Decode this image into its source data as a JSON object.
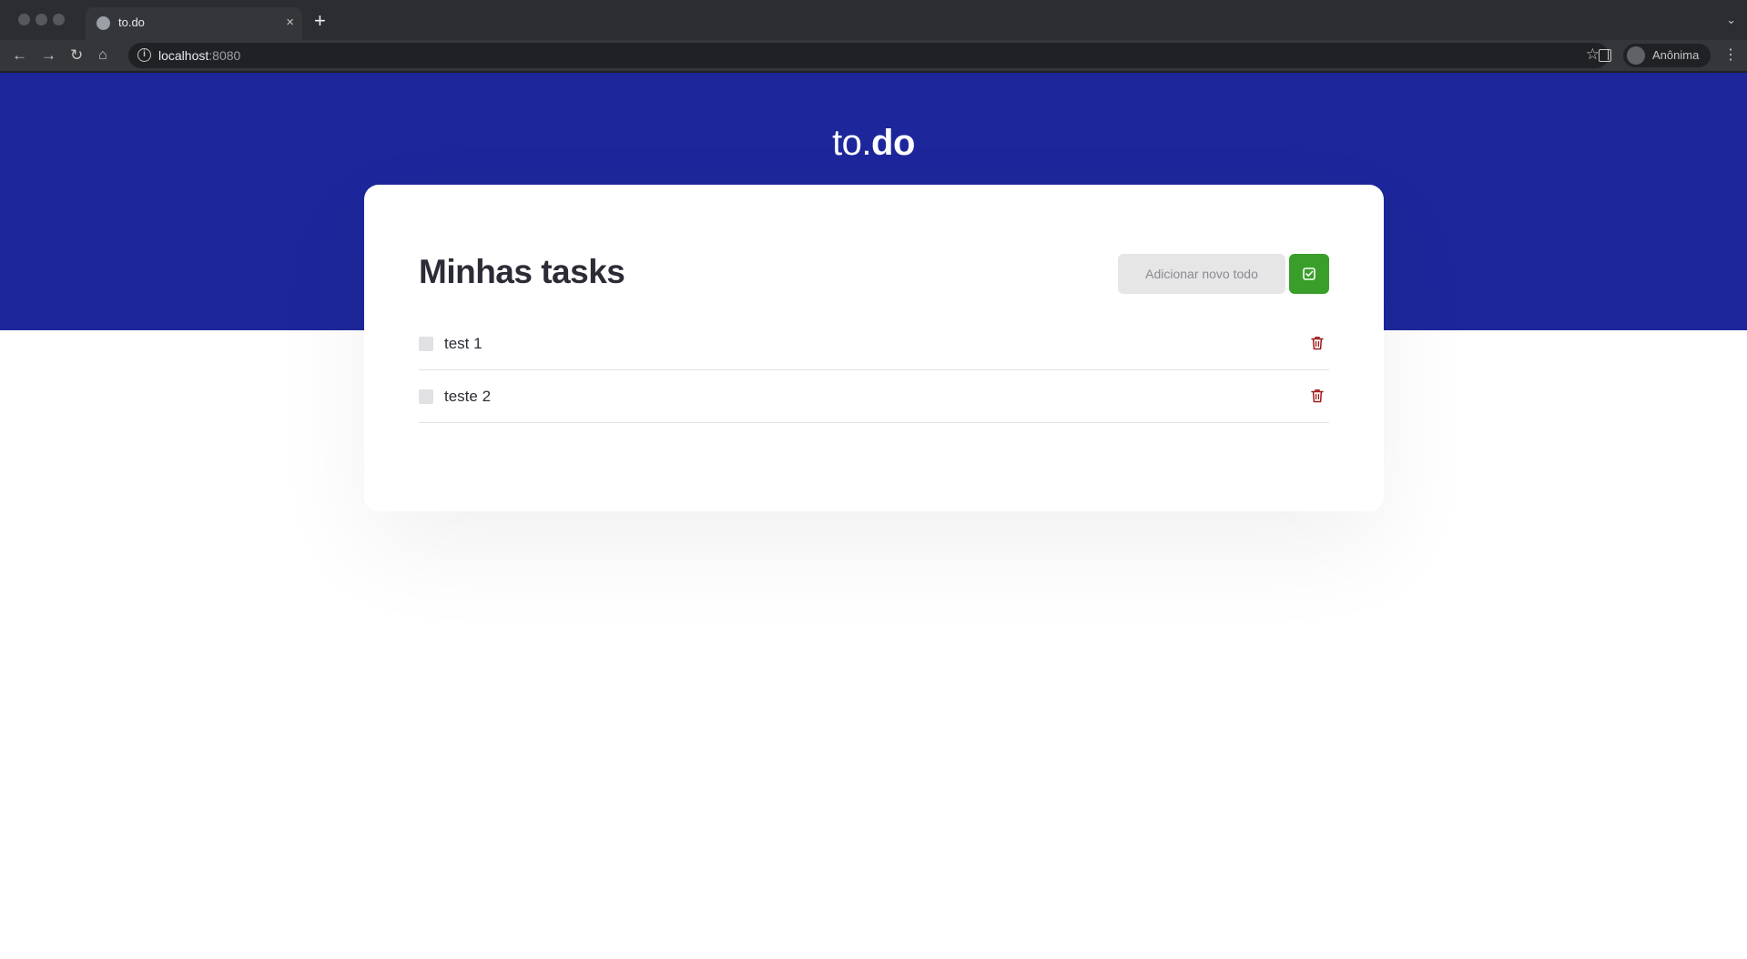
{
  "browser": {
    "tab_title": "to.do",
    "tab_close": "×",
    "new_tab": "+",
    "url_host": "localhost",
    "url_port": ":8080",
    "profile_label": "Anônima",
    "icons": [
      "back-icon",
      "forward-icon",
      "reload-icon",
      "home-icon",
      "info-icon",
      "star-icon",
      "side-panel-icon",
      "incognito-icon",
      "menu-icon"
    ]
  },
  "header": {
    "logo_light": "to.",
    "logo_bold": "do",
    "background": "#1d279b"
  },
  "tasks_panel": {
    "title": "Minhas tasks",
    "new_todo_placeholder": "Adicionar novo todo",
    "add_button_icon": "check-square-icon",
    "add_button_color": "#3a9f2a",
    "delete_icon_color": "#a11a1a",
    "items": [
      {
        "title": "test 1",
        "done": false
      },
      {
        "title": "teste 2",
        "done": false
      }
    ]
  }
}
